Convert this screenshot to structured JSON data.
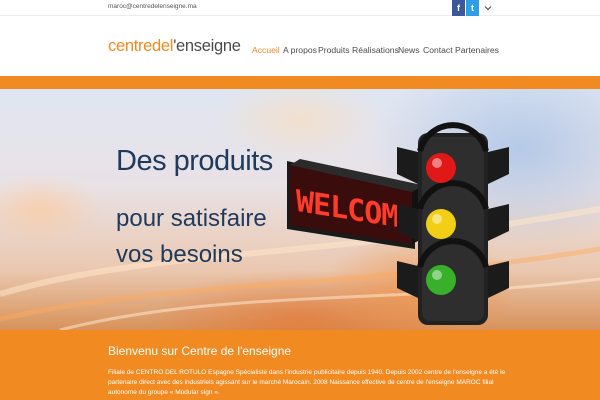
{
  "topbar": {
    "email": "maroc@centredelenseigne.ma",
    "facebook_icon": "facebook-icon",
    "twitter_icon": "twitter-icon",
    "dropdown_icon": "chevron-down-icon",
    "facebook_glyph": "f",
    "twitter_glyph": "t"
  },
  "logo": {
    "part1": "centredel",
    "part2": "'enseigne"
  },
  "nav": {
    "items": [
      {
        "label": "Accueil",
        "active": true
      },
      {
        "label": "A propos"
      },
      {
        "label": "Produits"
      },
      {
        "label": "Réalisations"
      },
      {
        "label": "News"
      },
      {
        "label": "Contact"
      },
      {
        "label": "Partenaires"
      }
    ]
  },
  "hero": {
    "line1": "Des produits",
    "line2": "pour satisfaire",
    "line3": "vos besoins",
    "sign_text": "WELCOM"
  },
  "welcome": {
    "title": "Bienvenu sur Centre de l'enseigne",
    "text": "Filiale de CENTRO DEL ROTULO Espagne Spécialiste dans l'industrie publicitaire depuis 1940. Depuis 2002 centre de l'enseigne a été le partenaire direct avec des industriels agissant sur le marché Marocain. 2008 Naissance effective de centre de l'enseigne MAROC filial autonome du groupe « Modular sign »."
  },
  "colors": {
    "accent": "#f08a21",
    "heading": "#1e3a5c",
    "facebook": "#3b5998",
    "twitter": "#2f9ee8"
  }
}
